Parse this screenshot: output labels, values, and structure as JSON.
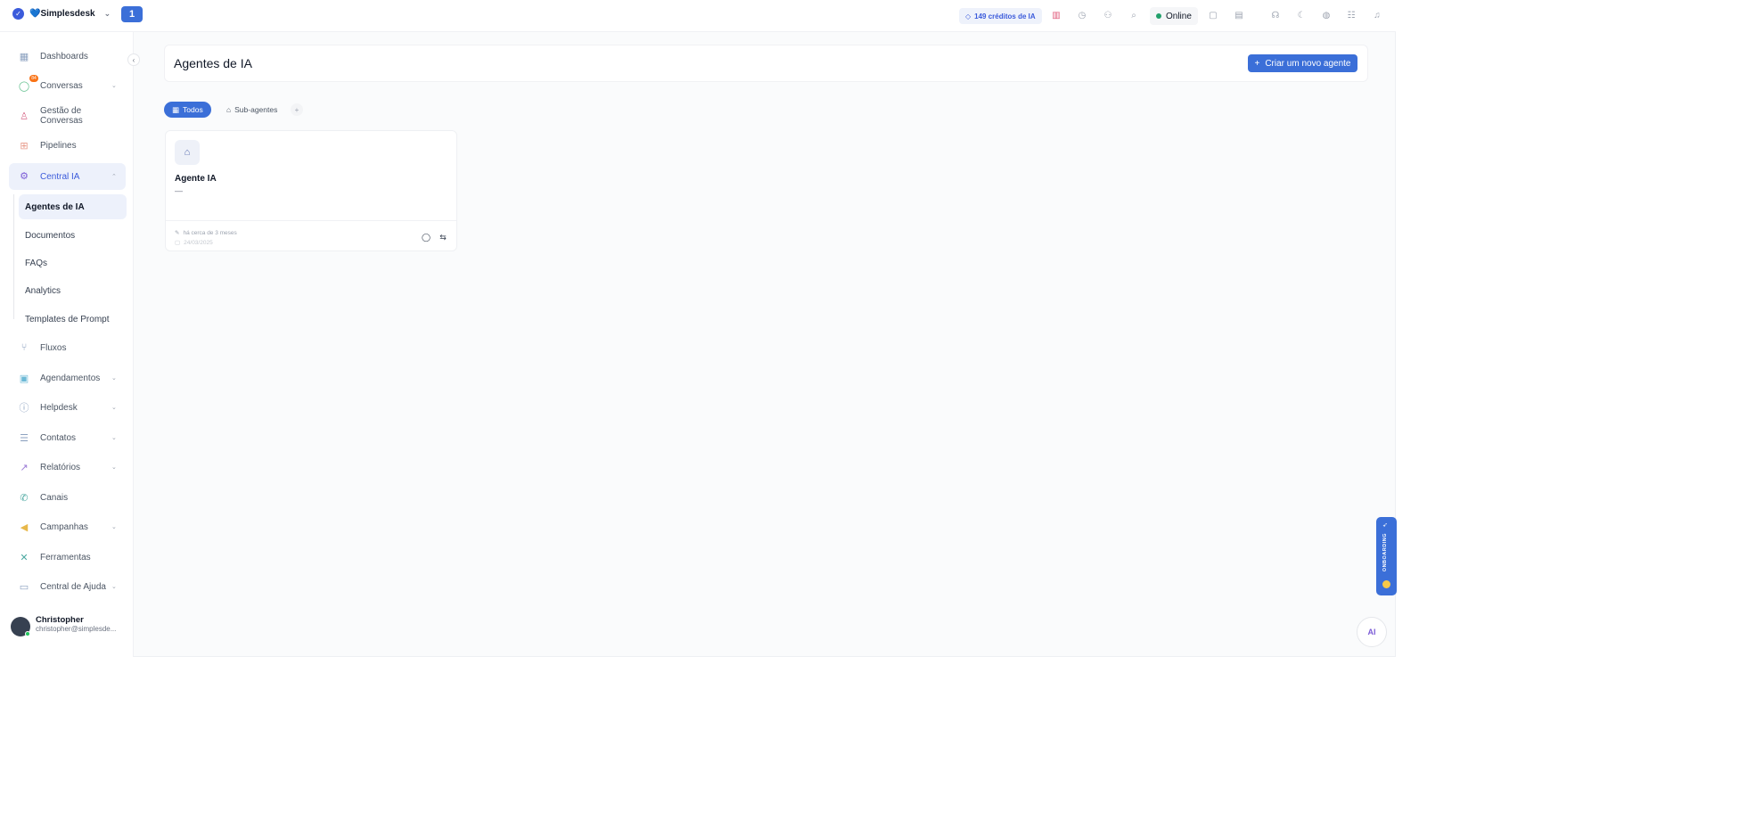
{
  "topbar": {
    "brand": "💙Simplesdesk",
    "badge": "1",
    "credits": "149 créditos de IA",
    "status": "Online"
  },
  "sidebar": {
    "items": [
      {
        "label": "Dashboards",
        "icon": "dashboard-icon"
      },
      {
        "label": "Conversas",
        "icon": "chat-icon",
        "badge": "84"
      },
      {
        "label": "Gestão de Conversas",
        "icon": "conversation-management-icon"
      },
      {
        "label": "Pipelines",
        "icon": "pipeline-icon"
      },
      {
        "label": "Central IA",
        "icon": "ai-icon"
      },
      {
        "label": "Fluxos",
        "icon": "flow-icon"
      },
      {
        "label": "Agendamentos",
        "icon": "calendar-icon"
      },
      {
        "label": "Helpdesk",
        "icon": "helpdesk-icon"
      },
      {
        "label": "Contatos",
        "icon": "contacts-icon"
      },
      {
        "label": "Relatórios",
        "icon": "chart-icon"
      },
      {
        "label": "Canais",
        "icon": "phone-icon"
      },
      {
        "label": "Campanhas",
        "icon": "megaphone-icon"
      },
      {
        "label": "Ferramentas",
        "icon": "tools-icon"
      },
      {
        "label": "Central de Ajuda",
        "icon": "help-icon"
      }
    ],
    "sub_items": [
      "Agentes de IA",
      "Documentos",
      "FAQs",
      "Analytics",
      "Templates de Prompt"
    ],
    "user": {
      "name": "Christopher",
      "email": "christopher@simplesde..."
    }
  },
  "main": {
    "title": "Agentes de IA",
    "create_button": "Criar um novo agente",
    "tabs": [
      "Todos",
      "Sub-agentes"
    ],
    "card": {
      "name": "Agente IA",
      "description": "—",
      "updated": "há cerca de 3 meses",
      "created": "24/03/2025"
    }
  },
  "floating": {
    "onboarding": "ONBOARDING",
    "ai_button": "AI"
  },
  "colors": {
    "accent": "#3b6fd8",
    "status_online": "#22a06b",
    "badge": "#f97316"
  }
}
